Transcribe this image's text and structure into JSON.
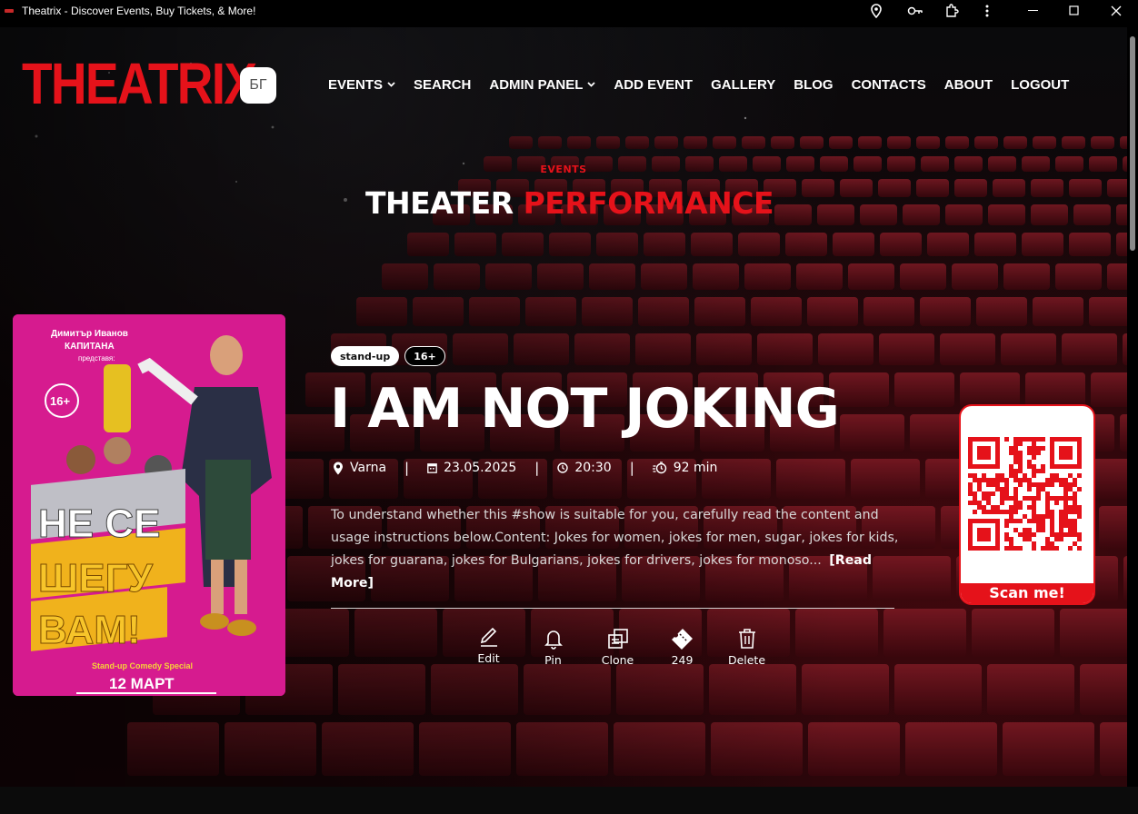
{
  "window": {
    "title": "Theatrix - Discover Events, Buy Tickets, & More!",
    "icons": [
      "location-icon",
      "key-icon",
      "extensions-icon",
      "more-icon"
    ],
    "controls": [
      "minimize-icon",
      "maximize-icon",
      "close-icon"
    ]
  },
  "brand": {
    "logo": "THEATRIX",
    "lang_button": "БГ",
    "accent": "#e5121a"
  },
  "nav": {
    "items": [
      {
        "label": "EVENTS",
        "dropdown": true
      },
      {
        "label": "SEARCH",
        "dropdown": false
      },
      {
        "label": "ADMIN PANEL",
        "dropdown": true
      },
      {
        "label": "ADD EVENT",
        "dropdown": false
      },
      {
        "label": "GALLERY",
        "dropdown": false
      },
      {
        "label": "BLOG",
        "dropdown": false
      },
      {
        "label": "CONTACTS",
        "dropdown": false
      },
      {
        "label": "ABOUT",
        "dropdown": false
      },
      {
        "label": "LOGOUT",
        "dropdown": false
      }
    ]
  },
  "hero": {
    "kicker": "EVENTS",
    "heading_white": "THEATER",
    "heading_red": "PERFORMANCE"
  },
  "event": {
    "tags": [
      "stand-up",
      "16+"
    ],
    "title": "I AM NOT JOKING",
    "location": "Varna",
    "date": "23.05.2025",
    "time": "20:30",
    "duration": "92 min",
    "description": "To understand whether this #show is suitable for you, carefully read the content and usage instructions below.Content: Jokes for women, jokes for men, sugar, jokes for kids, jokes for guarana, jokes for Bulgarians, jokes for drivers, jokes for monoso...",
    "read_more": "[Read More]"
  },
  "poster": {
    "top_line1": "Димитър Иванов",
    "top_line2": "КАПИТАНА",
    "top_line3": "представя:",
    "age_badge": "16+",
    "title_lines": [
      "НЕ СЕ",
      "ШЕГУ",
      "ВАМ!"
    ],
    "subtitle": "Stand-up Comedy Special",
    "date": "12 МАРТ",
    "bg_color": "#d61b8f"
  },
  "actions": [
    {
      "label": "Edit",
      "icon": "edit-icon"
    },
    {
      "label": "Pin",
      "icon": "bell-icon"
    },
    {
      "label": "Clone",
      "icon": "clone-icon"
    },
    {
      "label": "249",
      "icon": "ticket-icon"
    },
    {
      "label": "Delete",
      "icon": "trash-icon"
    }
  ],
  "qr": {
    "label": "Scan me!"
  }
}
